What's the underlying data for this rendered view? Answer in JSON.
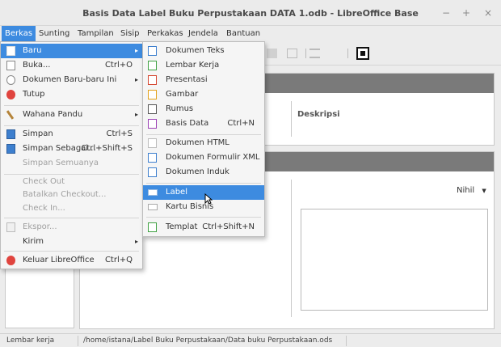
{
  "window": {
    "title": "Basis Data Label Buku Perpustakaan DATA 1.odb - LibreOffice Base",
    "controls": {
      "minimize": "−",
      "maximize": "+",
      "close": "×"
    }
  },
  "menubar": [
    "Berkas",
    "Sunting",
    "Tampilan",
    "Sisip",
    "Perkakas",
    "Jendela",
    "Bantuan"
  ],
  "menubar_active": "Berkas",
  "file_menu": {
    "items": [
      {
        "label": "Baru",
        "submenu": true,
        "icon": "new-doc-icon"
      },
      {
        "label": "Buka...",
        "shortcut": "Ctrl+O",
        "icon": "open-icon"
      },
      {
        "label": "Dokumen Baru-baru Ini",
        "submenu": true,
        "icon": "recent-icon"
      },
      {
        "label": "Tutup",
        "icon": "close-doc-icon"
      },
      {
        "label": "Wahana Pandu",
        "submenu": true,
        "icon": "wizard-icon"
      },
      {
        "label": "Simpan",
        "shortcut": "Ctrl+S",
        "icon": "save-icon"
      },
      {
        "label": "Simpan Sebagai...",
        "shortcut": "Ctrl+Shift+S",
        "icon": "save-as-icon"
      },
      {
        "label": "Simpan Semuanya",
        "disabled": true
      },
      {
        "label": "Check Out",
        "disabled": true
      },
      {
        "label": "Batalkan Checkout...",
        "disabled": true
      },
      {
        "label": "Check In...",
        "disabled": true
      },
      {
        "label": "Ekspor...",
        "disabled": true,
        "icon": "export-icon"
      },
      {
        "label": "Kirim",
        "submenu": true
      },
      {
        "label": "Keluar LibreOffice",
        "shortcut": "Ctrl+Q",
        "icon": "exit-icon"
      }
    ]
  },
  "new_submenu": {
    "items": [
      {
        "label": "Dokumen Teks",
        "icon": "writer-icon"
      },
      {
        "label": "Lembar Kerja",
        "icon": "calc-icon"
      },
      {
        "label": "Presentasi",
        "icon": "impress-icon"
      },
      {
        "label": "Gambar",
        "icon": "draw-icon"
      },
      {
        "label": "Rumus",
        "icon": "math-icon"
      },
      {
        "label": "Basis Data",
        "shortcut": "Ctrl+N",
        "icon": "base-icon"
      },
      {
        "label": "Dokumen HTML",
        "icon": "html-icon"
      },
      {
        "label": "Dokumen Formulir XML",
        "icon": "xml-form-icon"
      },
      {
        "label": "Dokumen Induk",
        "icon": "master-doc-icon"
      },
      {
        "label": "Label",
        "icon": "label-icon",
        "highlighted": true
      },
      {
        "label": "Kartu Bisnis",
        "icon": "business-card-icon"
      },
      {
        "label": "Templat",
        "shortcut": "Ctrl+Shift+N",
        "icon": "template-icon"
      }
    ]
  },
  "main": {
    "description_label": "Deskripsi",
    "preview_mode": "Nihil"
  },
  "statusbar": {
    "mode": "Lembar kerja",
    "path": "/home/istana/Label Buku Perpustakaan/Data buku Perpustakaan.ods"
  },
  "colors": {
    "accent": "#3d8be0",
    "panel_header": "#7a7a7a"
  }
}
